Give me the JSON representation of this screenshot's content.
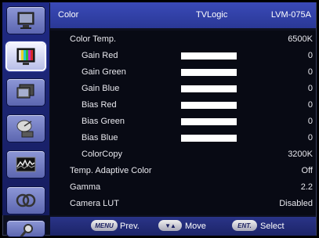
{
  "header": {
    "title": "Color",
    "brand": "TVLogic",
    "model": "LVM-075A"
  },
  "sidebar": {
    "items": [
      {
        "icon": "monitor-icon",
        "active": false
      },
      {
        "icon": "color-bars-icon",
        "active": true
      },
      {
        "icon": "display-setup-icon",
        "active": false
      },
      {
        "icon": "satellite-dish-icon",
        "active": false
      },
      {
        "icon": "waveform-icon",
        "active": false
      },
      {
        "icon": "marker-icon",
        "active": false
      },
      {
        "icon": "tool-icon",
        "active": false
      }
    ]
  },
  "menu": {
    "rows": [
      {
        "label": "Color Temp.",
        "value": "6500K",
        "indent": false,
        "bar": null,
        "selected": false
      },
      {
        "label": "Gain Red",
        "value": "0",
        "indent": true,
        "bar": 1.0,
        "selected": false
      },
      {
        "label": "Gain Green",
        "value": "0",
        "indent": true,
        "bar": 1.0,
        "selected": false
      },
      {
        "label": "Gain Blue",
        "value": "0",
        "indent": true,
        "bar": 1.0,
        "selected": false
      },
      {
        "label": "Bias Red",
        "value": "0",
        "indent": true,
        "bar": 1.0,
        "selected": false
      },
      {
        "label": "Bias Green",
        "value": "0",
        "indent": true,
        "bar": 1.0,
        "selected": false
      },
      {
        "label": "Bias Blue",
        "value": "0",
        "indent": true,
        "bar": 1.0,
        "selected": false
      },
      {
        "label": "ColorCopy",
        "value": "3200K",
        "indent": true,
        "bar": null,
        "selected": false
      },
      {
        "label": "Temp. Adaptive Color",
        "value": "Off",
        "indent": false,
        "bar": null,
        "selected": false
      },
      {
        "label": "Gamma",
        "value": "2.2",
        "indent": false,
        "bar": null,
        "selected": false
      },
      {
        "label": "Camera LUT",
        "value": "Disabled",
        "indent": false,
        "bar": null,
        "selected": false
      }
    ]
  },
  "footer": {
    "menu_key": "MENU",
    "prev_label": "Prev.",
    "move_key": "▼▲",
    "move_label": "Move",
    "ent_key": "ENT.",
    "select_label": "Select"
  }
}
